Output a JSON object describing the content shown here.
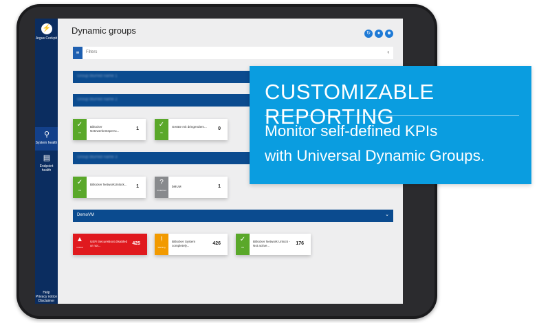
{
  "sidebar": {
    "app_name": "Argus Cockpit",
    "items": [
      {
        "label": "System health",
        "icon": "search-icon"
      },
      {
        "label": "Endpoint health",
        "icon": "document-icon"
      }
    ],
    "footer": [
      "Help",
      "Privacy notice",
      "Disclaimer"
    ]
  },
  "header": {
    "title": "Dynamic groups"
  },
  "filter": {
    "placeholder": "Filters"
  },
  "groups": [
    {
      "name": "Group blurred name 1",
      "blurred": true
    },
    {
      "name": "Group blurred name 2",
      "blurred": true,
      "kpis": [
        {
          "status": "Ok",
          "text": "Bitlocker Netzwerkentsperru...",
          "value": "1"
        },
        {
          "status": "Ok",
          "text": "Geräte mit dringendem...",
          "value": "0"
        }
      ]
    },
    {
      "name": "Group blurred name 3",
      "blurred": true,
      "kpis": [
        {
          "status": "Ok",
          "text": "Bitlocker NetworkUnlock...",
          "value": "1"
        },
        {
          "status": "Undefined",
          "text": "bMUM",
          "value": "1"
        }
      ]
    },
    {
      "name": "DemoVM",
      "blurred": false,
      "kpis": [
        {
          "status": "Critical",
          "text": "UEFI SecureBoot disabled or not...",
          "value": "425"
        },
        {
          "status": "Warning",
          "text": "Bitlocker System completely...",
          "value": "426"
        },
        {
          "status": "Ok",
          "text": "Bitlocker Network Unlock - Not active...",
          "value": "176"
        }
      ]
    }
  ],
  "status_colors": {
    "Ok": "#5aa82a",
    "Undefined": "#888a8d",
    "Critical": "#e0191e",
    "Warning": "#f29a00"
  },
  "banner": {
    "title": "CUSTOMIZABLE REPORTING",
    "line1": "Monitor self-defined KPIs",
    "line2": "with Universal Dynamic Groups."
  }
}
